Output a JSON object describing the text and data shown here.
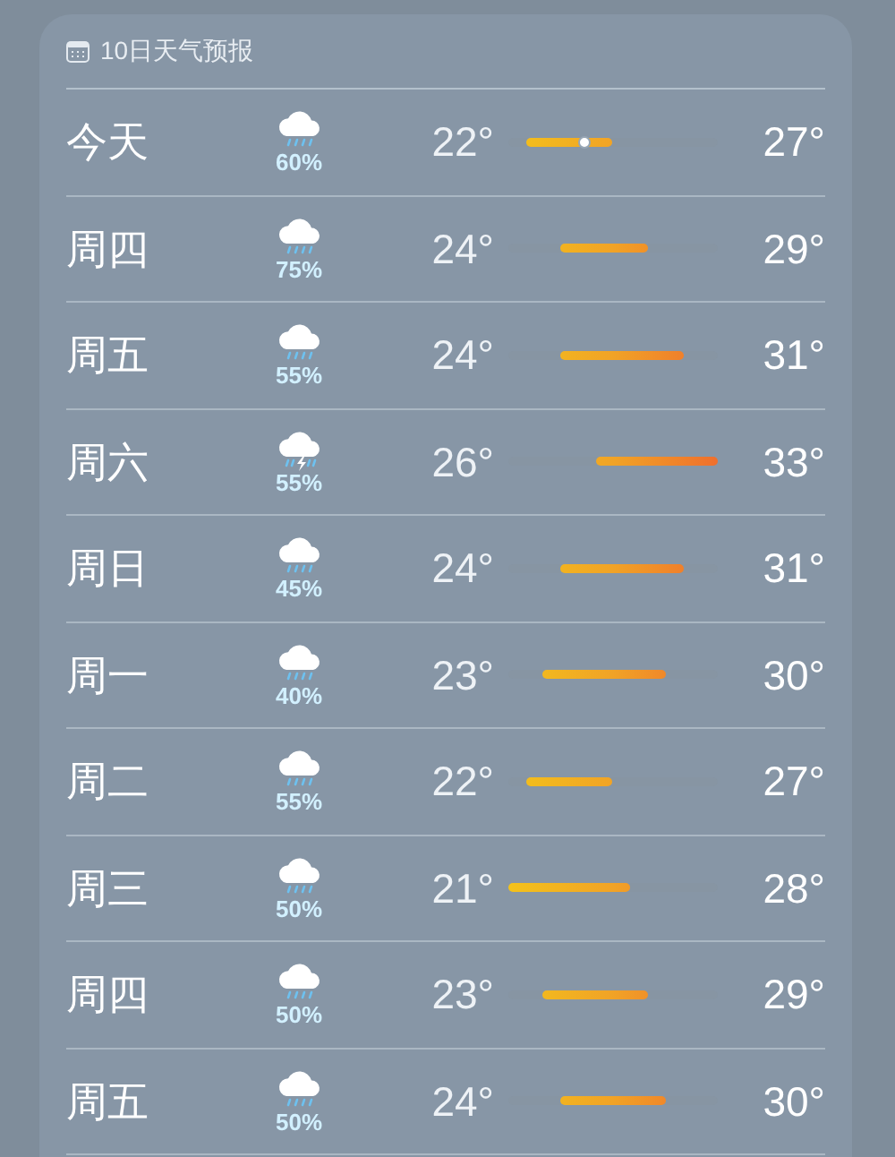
{
  "header": {
    "title": "10日天气预报"
  },
  "days": [
    {
      "day": "今天",
      "kind": "rain",
      "chance": "60%",
      "low": "22°",
      "high": "27°",
      "now": {
        "level": 0.36
      }
    },
    {
      "day": "周四",
      "kind": "rain",
      "chance": "75%",
      "low": "24°",
      "high": "29°"
    },
    {
      "day": "周五",
      "kind": "rain",
      "chance": "55%",
      "low": "24°",
      "high": "31°"
    },
    {
      "day": "周六",
      "kind": "thunder",
      "chance": "55%",
      "low": "26°",
      "high": "33°"
    },
    {
      "day": "周日",
      "kind": "rain",
      "chance": "45%",
      "low": "24°",
      "high": "31°"
    },
    {
      "day": "周一",
      "kind": "rain",
      "chance": "40%",
      "low": "23°",
      "high": "30°"
    },
    {
      "day": "周二",
      "kind": "rain",
      "chance": "55%",
      "low": "22°",
      "high": "27°"
    },
    {
      "day": "周三",
      "kind": "rain",
      "chance": "50%",
      "low": "21°",
      "high": "28°"
    },
    {
      "day": "周四",
      "kind": "rain",
      "chance": "50%",
      "low": "23°",
      "high": "29°"
    },
    {
      "day": "周五",
      "kind": "rain",
      "chance": "50%",
      "low": "24°",
      "high": "30°"
    }
  ]
}
